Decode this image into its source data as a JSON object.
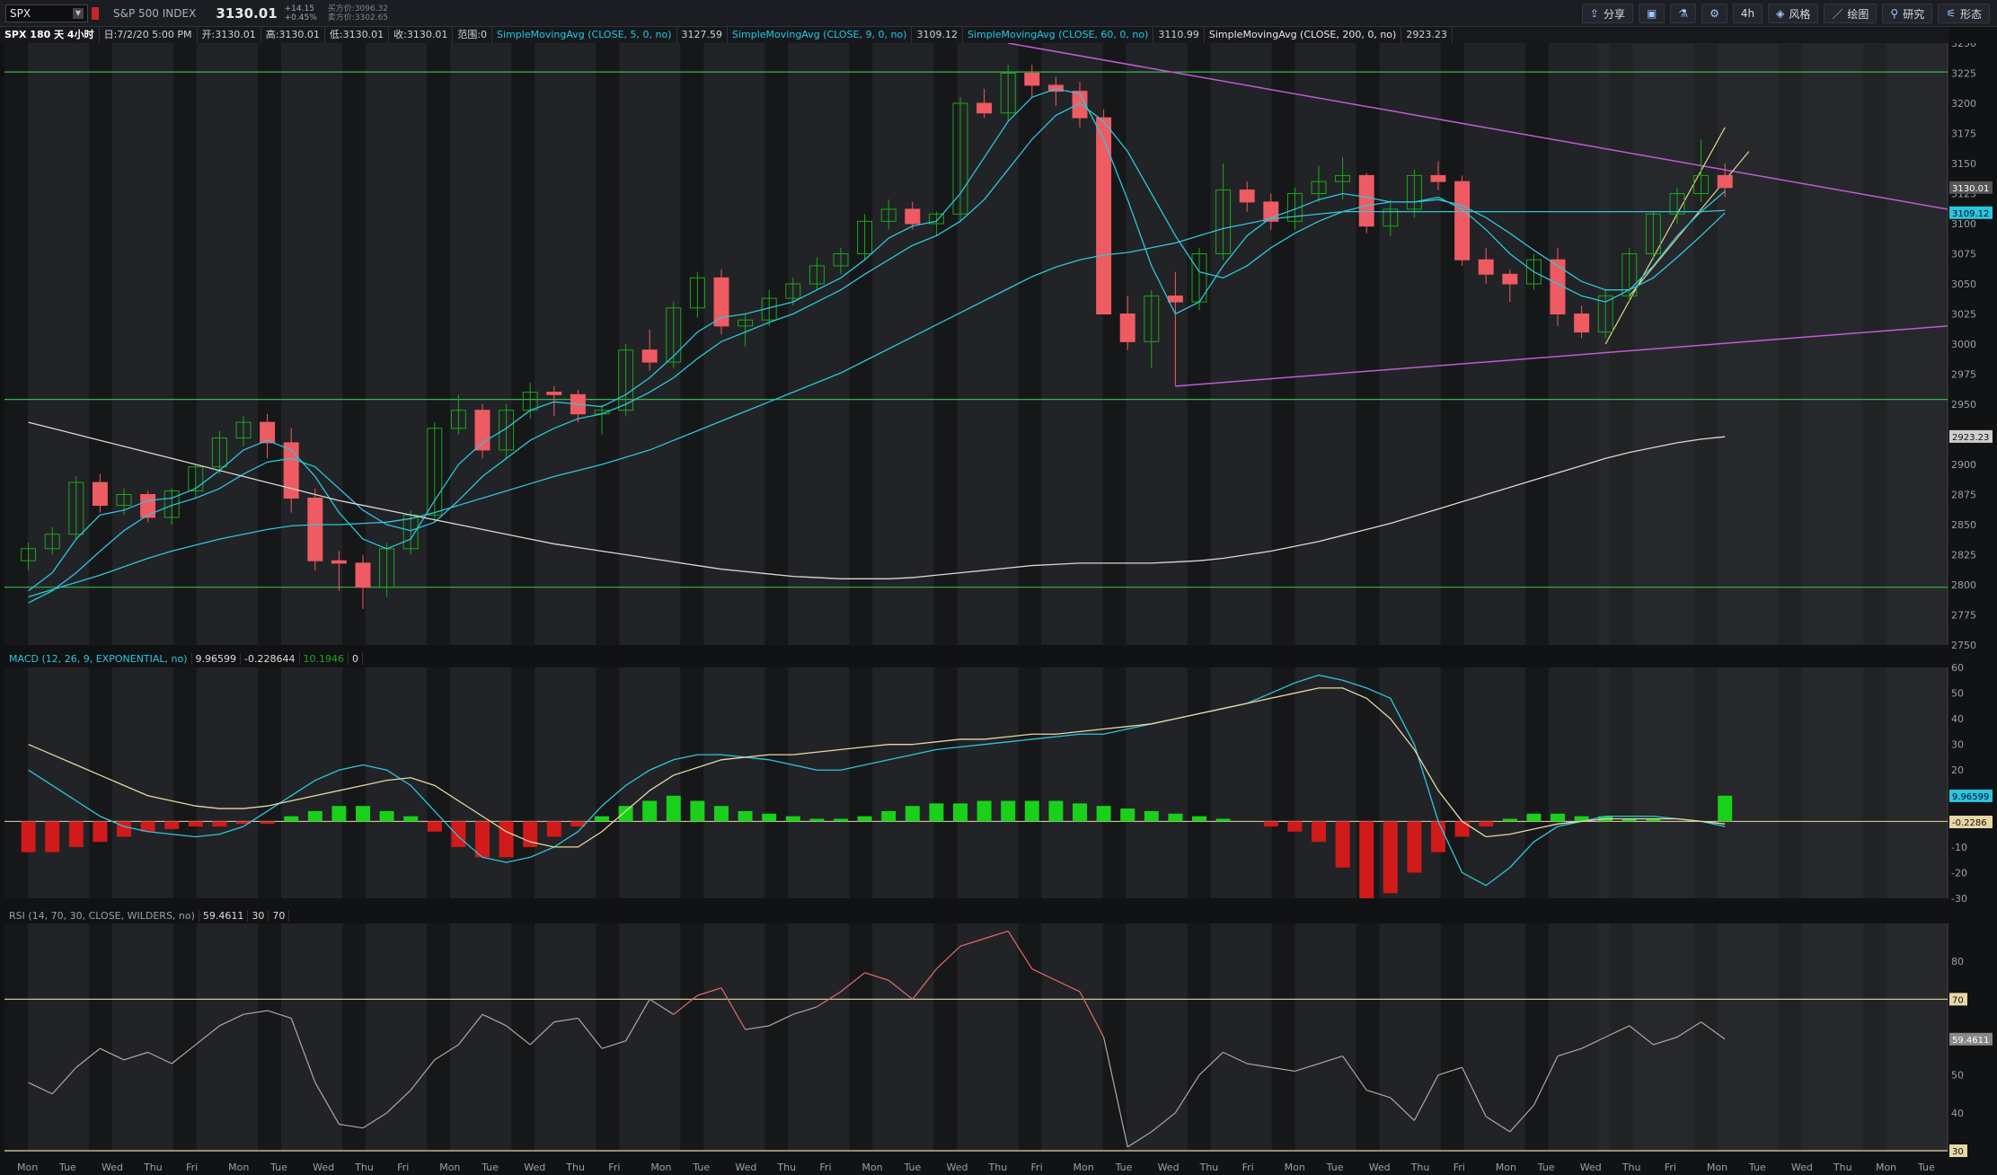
{
  "header": {
    "symbol": "SPX",
    "index_name": "S&P 500 INDEX",
    "last_price": "3130.01",
    "change": "+14.15",
    "change_pct": "+0.45%",
    "bid": "买方价:3096.32",
    "ask": "卖方价:3302.65"
  },
  "toolbar": [
    {
      "icon": "share-icon",
      "label": "分享"
    },
    {
      "icon": "screen-icon",
      "label": ""
    },
    {
      "icon": "flask-icon",
      "label": ""
    },
    {
      "icon": "gear-icon",
      "label": ""
    },
    {
      "icon": "",
      "label": "4h"
    },
    {
      "icon": "style-icon",
      "label": "风格"
    },
    {
      "icon": "draw-icon",
      "label": "绘图"
    },
    {
      "icon": "study-icon",
      "label": "研究"
    },
    {
      "icon": "pattern-icon",
      "label": "形态"
    }
  ],
  "infobar": {
    "title": "SPX 180 天 4小时",
    "date": "日:7/2/20 5:00 PM",
    "open": "开:3130.01",
    "high": "高:3130.01",
    "low": "低:3130.01",
    "close": "收:3130.01",
    "range": "范围:0",
    "sma5": "SimpleMovingAvg (CLOSE, 5, 0, no)",
    "sma5_val": "3127.59",
    "sma9": "SimpleMovingAvg (CLOSE, 9, 0, no)",
    "sma9_val": "3109.12",
    "sma60": "SimpleMovingAvg (CLOSE, 60, 0, no)",
    "sma60_val": "3110.99",
    "sma200": "SimpleMovingAvg (CLOSE, 200, 0, no)",
    "sma200_val": "2923.23"
  },
  "macd_info": {
    "label": "MACD (12, 26, 9, EXPONENTIAL, no)",
    "v1": "9.96599",
    "v2": "-0.228644",
    "v3": "10.1946",
    "v4": "0"
  },
  "rsi_info": {
    "label": "RSI (14, 70, 30, CLOSE, WILDERS, no)",
    "v1": "59.4611",
    "v2": "30",
    "v3": "70"
  },
  "colors": {
    "up": "#1aa81a",
    "down": "#ef5b62",
    "sma_fast": "#2cc6dc",
    "sma200": "#d8d8d8",
    "trend": "#c25bd6",
    "hline": "#35b84a",
    "signal": "#e7d7a4"
  },
  "chart_data": [
    {
      "type": "candlestick",
      "title": "SPX 180 天 4小时",
      "ylim": [
        2750,
        3250
      ],
      "y_ticks": [
        2750,
        2775,
        2800,
        2825,
        2850,
        2875,
        2900,
        2925,
        2950,
        2975,
        3000,
        3025,
        3050,
        3075,
        3100,
        3125,
        3150,
        3175,
        3200,
        3225,
        3250
      ],
      "x_ticks": [
        "Mon",
        "Tue",
        "Wed",
        "Thu",
        "Fri",
        "Mon",
        "Tue",
        "Wed",
        "Thu",
        "Fri",
        "Mon",
        "Tue",
        "Wed",
        "Thu",
        "Fri",
        "Mon",
        "Tue",
        "Wed",
        "Thu",
        "Fri",
        "Mon",
        "Tue",
        "Wed",
        "Thu",
        "Fri",
        "Mon",
        "Tue",
        "Wed",
        "Thu",
        "Fri",
        "Mon",
        "Tue",
        "Wed",
        "Thu",
        "Fri",
        "Mon",
        "Tue",
        "Wed",
        "Thu",
        "Fri",
        "Mon",
        "Tue",
        "Wed",
        "Thu",
        "Mon",
        "Tue"
      ],
      "candles": [
        [
          2820,
          2835,
          2812,
          2830
        ],
        [
          2830,
          2848,
          2825,
          2842
        ],
        [
          2842,
          2890,
          2838,
          2885
        ],
        [
          2885,
          2892,
          2860,
          2866
        ],
        [
          2866,
          2880,
          2858,
          2875
        ],
        [
          2875,
          2878,
          2852,
          2856
        ],
        [
          2856,
          2880,
          2850,
          2878
        ],
        [
          2878,
          2900,
          2872,
          2898
        ],
        [
          2898,
          2928,
          2892,
          2922
        ],
        [
          2922,
          2940,
          2915,
          2935
        ],
        [
          2935,
          2942,
          2905,
          2918
        ],
        [
          2918,
          2930,
          2860,
          2872
        ],
        [
          2872,
          2880,
          2812,
          2820
        ],
        [
          2820,
          2828,
          2795,
          2818
        ],
        [
          2818,
          2825,
          2780,
          2798
        ],
        [
          2798,
          2835,
          2790,
          2830
        ],
        [
          2830,
          2862,
          2825,
          2858
        ],
        [
          2858,
          2935,
          2852,
          2930
        ],
        [
          2930,
          2958,
          2925,
          2945
        ],
        [
          2945,
          2950,
          2905,
          2912
        ],
        [
          2912,
          2950,
          2905,
          2945
        ],
        [
          2945,
          2968,
          2938,
          2960
        ],
        [
          2960,
          2965,
          2940,
          2958
        ],
        [
          2958,
          2962,
          2935,
          2942
        ],
        [
          2942,
          2950,
          2925,
          2945
        ],
        [
          2945,
          3000,
          2940,
          2995
        ],
        [
          2995,
          3012,
          2978,
          2985
        ],
        [
          2985,
          3035,
          2980,
          3030
        ],
        [
          3030,
          3060,
          3022,
          3055
        ],
        [
          3055,
          3062,
          3008,
          3015
        ],
        [
          3015,
          3025,
          2998,
          3020
        ],
        [
          3020,
          3045,
          3015,
          3038
        ],
        [
          3038,
          3055,
          3032,
          3050
        ],
        [
          3050,
          3072,
          3045,
          3065
        ],
        [
          3065,
          3080,
          3058,
          3075
        ],
        [
          3075,
          3108,
          3070,
          3102
        ],
        [
          3102,
          3120,
          3095,
          3112
        ],
        [
          3112,
          3118,
          3095,
          3100
        ],
        [
          3100,
          3110,
          3090,
          3108
        ],
        [
          3108,
          3205,
          3102,
          3200
        ],
        [
          3200,
          3212,
          3188,
          3192
        ],
        [
          3192,
          3232,
          3185,
          3225
        ],
        [
          3225,
          3232,
          3205,
          3215
        ],
        [
          3215,
          3222,
          3198,
          3210
        ],
        [
          3210,
          3218,
          3180,
          3188
        ],
        [
          3188,
          3195,
          3120,
          3025
        ],
        [
          3025,
          3040,
          2995,
          3002
        ],
        [
          3002,
          3045,
          2980,
          3040
        ],
        [
          3040,
          3060,
          2965,
          3035
        ],
        [
          3035,
          3080,
          3028,
          3075
        ],
        [
          3075,
          3150,
          3070,
          3128
        ],
        [
          3128,
          3135,
          3110,
          3118
        ],
        [
          3118,
          3125,
          3095,
          3102
        ],
        [
          3102,
          3130,
          3095,
          3125
        ],
        [
          3125,
          3148,
          3118,
          3135
        ],
        [
          3135,
          3155,
          3120,
          3140
        ],
        [
          3140,
          3142,
          3092,
          3098
        ],
        [
          3098,
          3120,
          3090,
          3112
        ],
        [
          3112,
          3145,
          3105,
          3140
        ],
        [
          3140,
          3152,
          3128,
          3135
        ],
        [
          3135,
          3140,
          3065,
          3070
        ],
        [
          3070,
          3080,
          3050,
          3058
        ],
        [
          3058,
          3062,
          3035,
          3050
        ],
        [
          3050,
          3075,
          3045,
          3070
        ],
        [
          3070,
          3080,
          3015,
          3025
        ],
        [
          3025,
          3032,
          3005,
          3010
        ],
        [
          3010,
          3045,
          3005,
          3040
        ],
        [
          3040,
          3080,
          3035,
          3075
        ],
        [
          3075,
          3110,
          3070,
          3108
        ],
        [
          3108,
          3130,
          3100,
          3125
        ],
        [
          3125,
          3170,
          3118,
          3140
        ],
        [
          3140,
          3150,
          3122,
          3130
        ]
      ],
      "sma5": [
        2795,
        2810,
        2838,
        2858,
        2862,
        2870,
        2872,
        2880,
        2895,
        2912,
        2920,
        2912,
        2890,
        2860,
        2838,
        2830,
        2838,
        2870,
        2900,
        2918,
        2930,
        2945,
        2952,
        2950,
        2948,
        2958,
        2972,
        2990,
        3010,
        3022,
        3025,
        3030,
        3035,
        3045,
        3055,
        3070,
        3088,
        3098,
        3102,
        3125,
        3155,
        3185,
        3205,
        3212,
        3208,
        3170,
        3120,
        3065,
        3025,
        3035,
        3065,
        3090,
        3105,
        3112,
        3120,
        3125,
        3122,
        3118,
        3118,
        3122,
        3112,
        3095,
        3075,
        3060,
        3050,
        3040,
        3035,
        3045,
        3065,
        3090,
        3110,
        3127
      ],
      "sma9": [
        2785,
        2795,
        2810,
        2828,
        2845,
        2858,
        2866,
        2872,
        2880,
        2892,
        2902,
        2905,
        2898,
        2880,
        2862,
        2850,
        2845,
        2852,
        2870,
        2890,
        2905,
        2920,
        2930,
        2938,
        2942,
        2950,
        2960,
        2972,
        2988,
        3002,
        3010,
        3018,
        3025,
        3035,
        3045,
        3058,
        3070,
        3082,
        3090,
        3102,
        3120,
        3145,
        3170,
        3190,
        3200,
        3185,
        3160,
        3125,
        3090,
        3060,
        3055,
        3065,
        3080,
        3092,
        3102,
        3110,
        3115,
        3118,
        3118,
        3120,
        3115,
        3105,
        3092,
        3078,
        3065,
        3052,
        3045,
        3045,
        3055,
        3072,
        3090,
        3109
      ],
      "sma60": [
        2790,
        2796,
        2802,
        2808,
        2815,
        2822,
        2828,
        2833,
        2838,
        2842,
        2846,
        2849,
        2850,
        2850,
        2851,
        2852,
        2855,
        2860,
        2866,
        2872,
        2878,
        2884,
        2890,
        2895,
        2900,
        2906,
        2912,
        2920,
        2928,
        2936,
        2944,
        2952,
        2960,
        2968,
        2976,
        2986,
        2996,
        3006,
        3016,
        3026,
        3036,
        3046,
        3056,
        3064,
        3070,
        3074,
        3076,
        3080,
        3084,
        3090,
        3096,
        3100,
        3104,
        3106,
        3108,
        3110,
        3110,
        3110,
        3110,
        3110,
        3110,
        3110,
        3110,
        3110,
        3110,
        3110,
        3110,
        3110,
        3110,
        3110,
        3110,
        3111
      ],
      "sma200": [
        2935,
        2930,
        2925,
        2920,
        2915,
        2910,
        2905,
        2900,
        2895,
        2890,
        2885,
        2880,
        2875,
        2870,
        2866,
        2862,
        2858,
        2854,
        2850,
        2846,
        2842,
        2838,
        2834,
        2831,
        2828,
        2825,
        2822,
        2819,
        2816,
        2813,
        2811,
        2809,
        2807,
        2806,
        2805,
        2805,
        2805,
        2806,
        2808,
        2810,
        2812,
        2814,
        2816,
        2817,
        2818,
        2818,
        2818,
        2818,
        2819,
        2820,
        2822,
        2825,
        2828,
        2832,
        2836,
        2841,
        2846,
        2851,
        2857,
        2863,
        2869,
        2875,
        2881,
        2887,
        2893,
        2899,
        2905,
        2910,
        2914,
        2918,
        2921,
        2923
      ],
      "hlines": [
        3226,
        2954,
        2798
      ],
      "last_price": 3130.01,
      "sma9_label": 3109.12,
      "sma200_label": 2923.23
    },
    {
      "type": "bar",
      "title": "MACD (12, 26, 9, EXPONENTIAL, no)",
      "ylim": [
        -30,
        60
      ],
      "y_ticks": [
        -30,
        -20,
        -10,
        0,
        10,
        20,
        30,
        40,
        50,
        60
      ],
      "macd": [
        20,
        14,
        8,
        2,
        -2,
        -4,
        -5,
        -6,
        -5,
        -2,
        4,
        10,
        16,
        20,
        22,
        20,
        14,
        4,
        -6,
        -14,
        -16,
        -14,
        -10,
        -4,
        6,
        14,
        20,
        24,
        26,
        26,
        25,
        24,
        22,
        20,
        20,
        22,
        24,
        26,
        28,
        29,
        30,
        31,
        32,
        33,
        34,
        34,
        36,
        38,
        40,
        42,
        44,
        46,
        50,
        54,
        57,
        55,
        52,
        48,
        30,
        0,
        -20,
        -25,
        -18,
        -8,
        -2,
        0,
        2,
        2,
        2,
        1,
        0,
        -2
      ],
      "signal": [
        30,
        26,
        22,
        18,
        14,
        10,
        8,
        6,
        5,
        5,
        6,
        8,
        10,
        12,
        14,
        16,
        17,
        14,
        8,
        2,
        -4,
        -8,
        -10,
        -10,
        -4,
        4,
        12,
        18,
        21,
        24,
        25,
        26,
        26,
        27,
        28,
        29,
        30,
        30,
        31,
        32,
        32,
        33,
        34,
        34,
        35,
        36,
        37,
        38,
        40,
        42,
        44,
        46,
        48,
        50,
        52,
        52,
        48,
        40,
        28,
        12,
        0,
        -6,
        -5,
        -3,
        -1,
        0,
        1,
        1,
        1,
        1,
        0,
        -1
      ],
      "histogram": [
        -12,
        -12,
        -10,
        -8,
        -6,
        -4,
        -3,
        -2,
        -2,
        -1,
        -1,
        2,
        4,
        6,
        6,
        4,
        2,
        -4,
        -10,
        -14,
        -14,
        -10,
        -6,
        -2,
        2,
        6,
        8,
        10,
        8,
        6,
        4,
        3,
        2,
        1,
        1,
        2,
        4,
        6,
        7,
        7,
        8,
        8,
        8,
        8,
        7,
        6,
        5,
        4,
        3,
        2,
        1,
        0,
        -2,
        -4,
        -8,
        -18,
        -30,
        -28,
        -20,
        -12,
        -6,
        -2,
        1,
        3,
        3,
        2,
        2,
        1,
        1,
        0,
        0,
        10
      ],
      "hline": 0,
      "labels": [
        9.96599,
        -0.2286
      ]
    },
    {
      "type": "line",
      "title": "RSI (14, 70, 30, CLOSE, WILDERS, no)",
      "ylim": [
        30,
        90
      ],
      "y_ticks": [
        30,
        40,
        50,
        60,
        70,
        80
      ],
      "values": [
        48,
        45,
        52,
        57,
        54,
        56,
        53,
        58,
        63,
        66,
        67,
        65,
        48,
        37,
        36,
        40,
        46,
        54,
        58,
        66,
        63,
        58,
        64,
        65,
        57,
        59,
        70,
        66,
        71,
        73,
        62,
        63,
        66,
        68,
        72,
        77,
        75,
        70,
        78,
        84,
        86,
        88,
        78,
        75,
        72,
        60,
        31,
        35,
        40,
        50,
        56,
        53,
        52,
        51,
        53,
        55,
        46,
        44,
        38,
        50,
        52,
        39,
        35,
        42,
        55,
        57,
        60,
        63,
        58,
        60,
        64,
        59.46
      ],
      "hlines": [
        70,
        30
      ],
      "label": 59.4611
    }
  ]
}
